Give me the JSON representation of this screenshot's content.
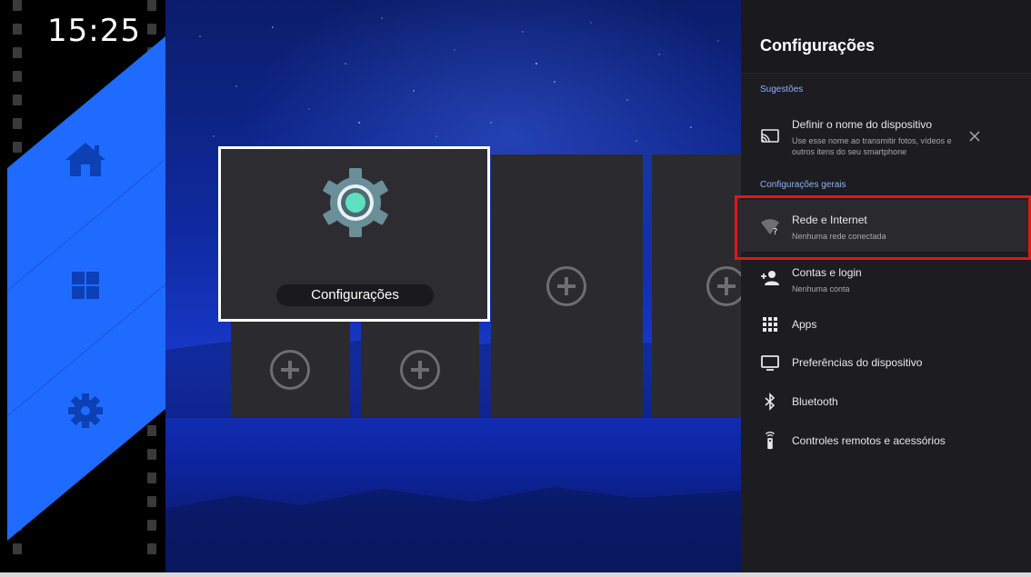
{
  "clock": {
    "time": "15:25"
  },
  "launcher": {
    "nav": [
      {
        "name": "home",
        "icon": "home-icon"
      },
      {
        "name": "apps",
        "icon": "windows-grid-icon"
      },
      {
        "name": "settings",
        "icon": "gear-icon"
      }
    ],
    "accent_color": "#1f6bff",
    "nav_icon_color": "#0d3fb5",
    "featured_tile": {
      "label": "Configurações",
      "icon": "settings-gear-icon"
    },
    "empty_tiles": [
      {
        "icon": "add-circle-icon"
      },
      {
        "icon": "add-circle-icon"
      },
      {
        "icon": "add-circle-icon"
      },
      {
        "icon": "add-circle-icon"
      },
      {
        "icon": "add-circle-icon"
      }
    ]
  },
  "settings_panel": {
    "title": "Configurações",
    "sections": {
      "suggestions": "Sugestões",
      "general": "Configurações gerais"
    },
    "suggestion": {
      "title": "Definir o nome do dispositivo",
      "subtitle_line1": "Use esse nome ao transmitir fotos, vídeos e",
      "subtitle_line2": "outros itens do seu smartphone",
      "icon": "cast-icon",
      "dismiss_icon": "close-icon"
    },
    "items": [
      {
        "title": "Rede e Internet",
        "subtitle": "Nenhuma rede conectada",
        "icon": "wifi-unknown-icon"
      },
      {
        "title": "Contas e login",
        "subtitle": "Nenhuma conta",
        "icon": "add-person-icon"
      },
      {
        "title": "Apps",
        "icon": "apps-grid-icon"
      },
      {
        "title": "Preferências do dispositivo",
        "icon": "tv-icon"
      },
      {
        "title": "Bluetooth",
        "icon": "bluetooth-icon"
      },
      {
        "title": "Controles remotos e acessórios",
        "icon": "remote-icon"
      }
    ],
    "highlight_color": "#e01717",
    "section_color": "#8ab4f8"
  }
}
